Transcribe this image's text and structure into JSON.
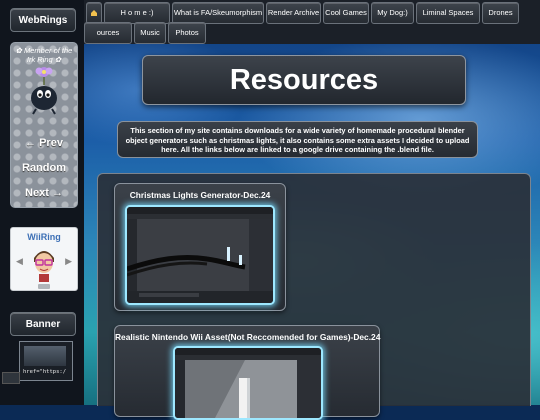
{
  "sidebar": {
    "webrings_label": "WebRings",
    "member_text": "✿ Member of the Irk Ring ✿",
    "prev_label": "← Prev",
    "random_label": "Random",
    "next_label": "Next →",
    "wiiring_title": "WiiRing",
    "banner_label": "Banner",
    "banner_caption": "href=\"https:/"
  },
  "nav": {
    "tabs": [
      "H o m e :)",
      "What is FA/Skeumorphism",
      "Render Archive",
      "Cool Games",
      "My Dog:)",
      "Liminal Spaces",
      "Drones",
      "ources",
      "Music",
      "Photos"
    ]
  },
  "page": {
    "title": "Resources",
    "intro": "This section of my site contains downloads for a wide variety of homemade procedural blender object generators such as christmas lights, it also contains some extra assets I decided to upload here. All the links below are linked to a google drive containing the .blend file."
  },
  "cards": [
    {
      "title": "Christmas Lights Generator-Dec.24"
    },
    {
      "title": "Realistic Nintendo Wii Asset(Not Reccomended for Games)-Dec.24"
    }
  ],
  "colors": {
    "accent_glow": "#9ee8ff",
    "panel": "#2a3038",
    "sidebar": "#10151d"
  }
}
